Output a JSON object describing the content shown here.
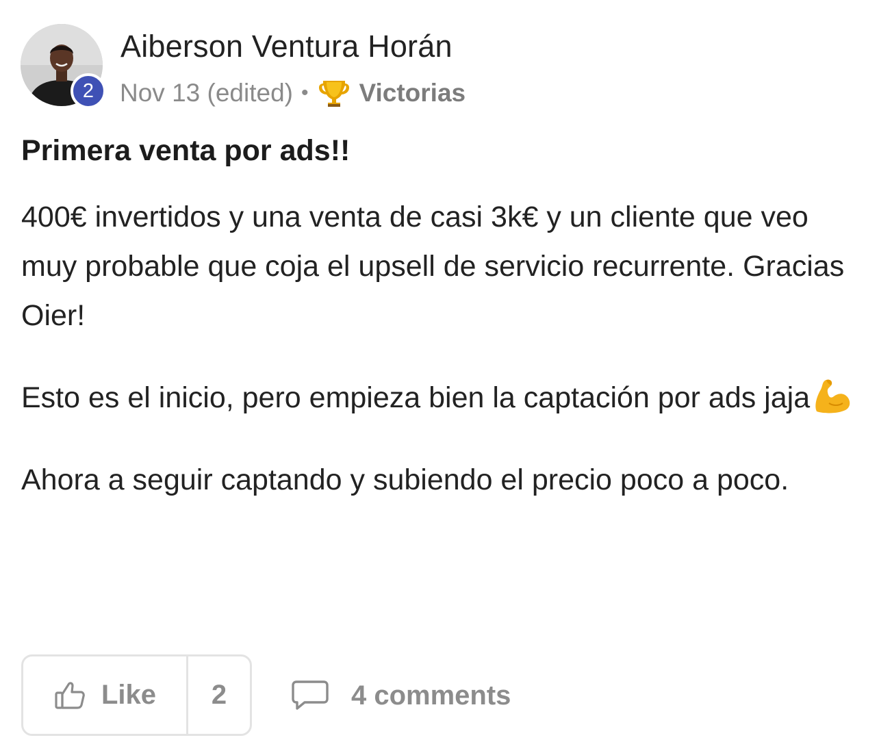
{
  "post": {
    "author": {
      "name": "Aiberson Ventura Horán",
      "level": "2",
      "avatar_icon": "user-avatar-photo"
    },
    "meta": {
      "date": "Nov 13 (edited)",
      "separator": "•",
      "category_icon": "trophy-icon",
      "category": "Victorias"
    },
    "title": "Primera venta por ads!!",
    "paragraphs": [
      "400€ invertidos y una venta de casi 3k€ y un cliente que veo muy probable que coja el upsell de servicio recurrente. Gracias Oier!",
      "Esto es el inicio, pero empieza bien la captación por ads jaja",
      "Ahora a seguir captando y subiendo el precio poco a poco."
    ],
    "paragraph_2_emoji": "flexed-biceps-emoji"
  },
  "actions": {
    "like_icon": "thumbs-up-icon",
    "like_label": "Like",
    "like_count": "2",
    "comment_icon": "comment-bubble-icon",
    "comments_label": "4 comments"
  },
  "colors": {
    "level_badge": "#3f51b5",
    "meta_text": "#8a8a8a",
    "action_text": "#8c8c8c",
    "border": "#e3e3e3"
  }
}
